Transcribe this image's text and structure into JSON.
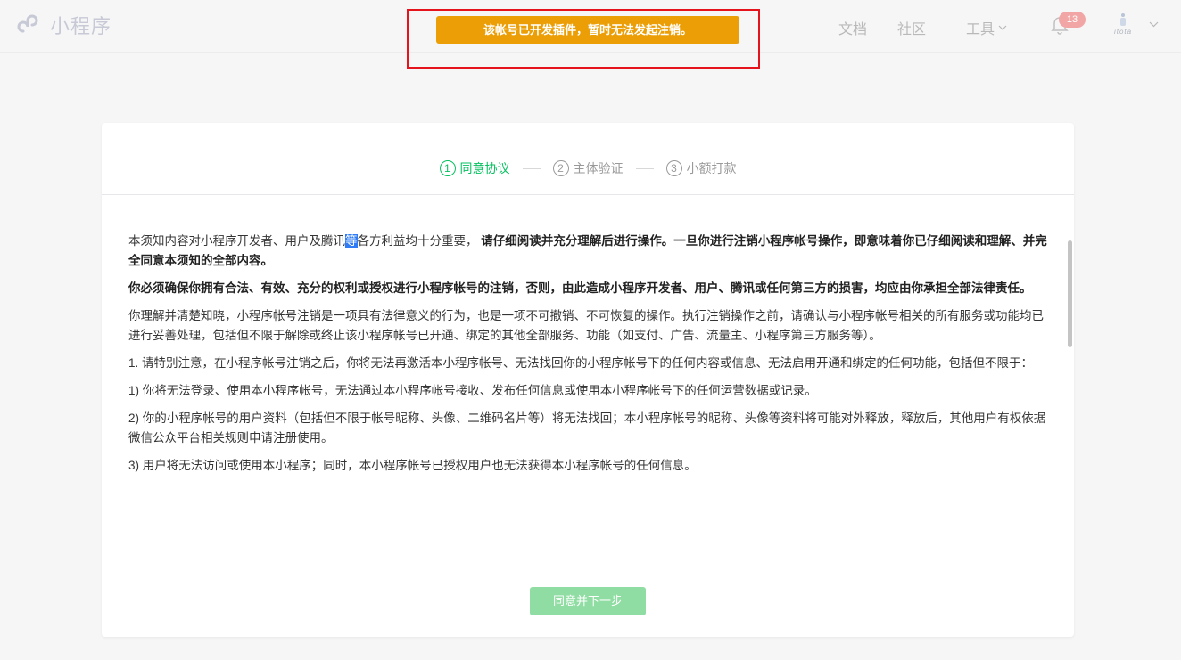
{
  "header": {
    "app_title": "小程序",
    "nav": {
      "docs": "文档",
      "community": "社区",
      "tools": "工具"
    },
    "notification_count": "13",
    "avatar_label": "itota"
  },
  "toast": {
    "message": "该帐号已开发插件，暂时无法发起注销。"
  },
  "steps": [
    {
      "num": "1",
      "label": "同意协议"
    },
    {
      "num": "2",
      "label": "主体验证"
    },
    {
      "num": "3",
      "label": "小额打款"
    }
  ],
  "agreement": {
    "p1_prefix": "本须知内容对小程序开发者、用户及腾讯",
    "p1_selected": "等",
    "p1_mid": "各方利益均十分重要，",
    "p1_bold": "请仔细阅读并充分理解后进行操作。一旦你进行注销小程序帐号操作，即意味着你已仔细阅读和理解、并完全同意本须知的全部内容。",
    "p2_bold": "你必须确保你拥有合法、有效、充分的权利或授权进行小程序帐号的注销，否则，由此造成小程序开发者、用户、腾讯或任何第三方的损害，均应由你承担全部法律责任。",
    "p3": "你理解并清楚知晓，小程序帐号注销是一项具有法律意义的行为，也是一项不可撤销、不可恢复的操作。执行注销操作之前，请确认与小程序帐号相关的所有服务或功能均已进行妥善处理，包括但不限于解除或终止该小程序帐号已开通、绑定的其他全部服务、功能（如支付、广告、流量主、小程序第三方服务等）。",
    "p4": "1. 请特别注意，在小程序帐号注销之后，你将无法再激活本小程序帐号、无法找回你的小程序帐号下的任何内容或信息、无法启用开通和绑定的任何功能，包括但不限于：",
    "p5": "1) 你将无法登录、使用本小程序帐号，无法通过本小程序帐号接收、发布任何信息或使用本小程序帐号下的任何运营数据或记录。",
    "p6": "2) 你的小程序帐号的用户资料（包括但不限于帐号昵称、头像、二维码名片等）将无法找回；本小程序帐号的昵称、头像等资料将可能对外释放，释放后，其他用户有权依据微信公众平台相关规则申请注册使用。",
    "p7": "3) 用户将无法访问或使用本小程序；同时，本小程序帐号已授权用户也无法获得本小程序帐号的任何信息。"
  },
  "next_button": "同意并下一步",
  "colors": {
    "brand_green": "#07c160",
    "toast_bg": "#eb9e05",
    "highlight_frame": "#e5131b",
    "disabled_button": "#8fdda2"
  },
  "icons": {
    "logo": "mini-program-logo-icon",
    "bell": "bell-icon",
    "chevron": "chevron-down-icon"
  }
}
